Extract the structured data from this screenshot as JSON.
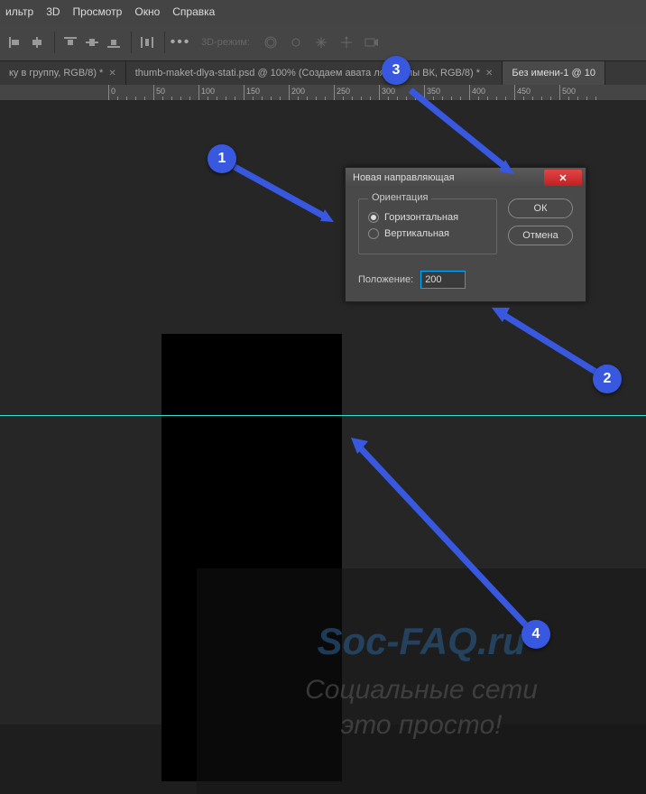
{
  "menu": {
    "items": [
      "ильтр",
      "3D",
      "Просмотр",
      "Окно",
      "Справка"
    ]
  },
  "toolbar": {
    "mode_label": "3D-режим:"
  },
  "tabs": [
    {
      "label": "ку в группу, RGB/8) *",
      "active": false,
      "closable": true
    },
    {
      "label": "thumb-maket-dlya-stati.psd @ 100% (Создаем авата       ля группы ВК, RGB/8) *",
      "active": false,
      "closable": true
    },
    {
      "label": "Без имени-1 @ 10",
      "active": true,
      "closable": false
    }
  ],
  "ruler": {
    "ticks": [
      0,
      50,
      100,
      150,
      200,
      250,
      300,
      350,
      400,
      450,
      500
    ]
  },
  "dialog": {
    "title": "Новая направляющая",
    "group_legend": "Ориентация",
    "opt_horizontal": "Горизонтальная",
    "opt_vertical": "Вертикальная",
    "position_label": "Положение:",
    "position_value": "200",
    "ok": "ОК",
    "cancel": "Отмена"
  },
  "badges": {
    "b1": "1",
    "b2": "2",
    "b3": "3",
    "b4": "4"
  },
  "content": {
    "brand": "Soc-FAQ.ru",
    "tagline1": "Социальные сети",
    "tagline2": "это просто!"
  }
}
